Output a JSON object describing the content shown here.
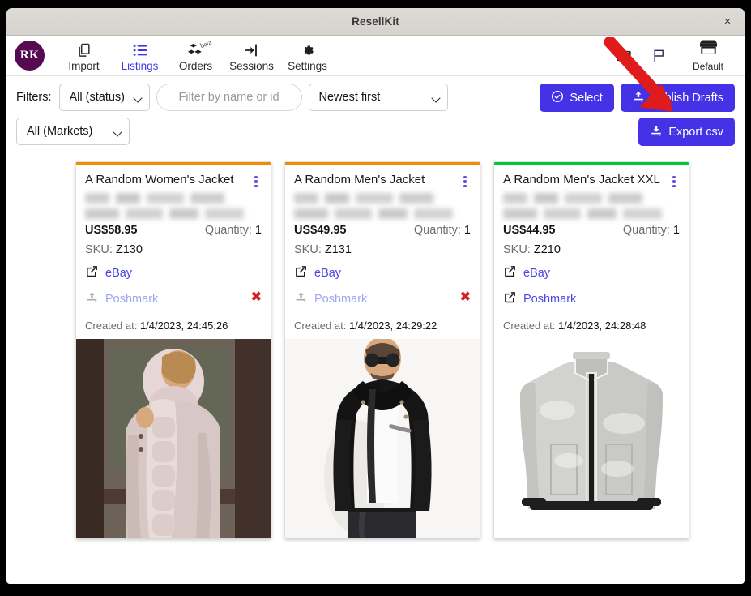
{
  "window": {
    "title": "ResellKit",
    "close_label": "×"
  },
  "nav": {
    "brand_initials": "RK",
    "items": [
      {
        "label": "Import",
        "icon": "copy-icon",
        "active": false,
        "badge": ""
      },
      {
        "label": "Listings",
        "icon": "list-icon",
        "active": true,
        "badge": ""
      },
      {
        "label": "Orders",
        "icon": "boxes-icon",
        "active": false,
        "badge": "beta"
      },
      {
        "label": "Sessions",
        "icon": "sign-in-icon",
        "active": false,
        "badge": ""
      },
      {
        "label": "Settings",
        "icon": "gear-icon",
        "active": false,
        "badge": ""
      }
    ],
    "mail_icon": "envelope-icon",
    "flag_icon": "flag-icon",
    "market": {
      "label": "Default",
      "icon": "storefront-icon"
    }
  },
  "filters": {
    "label": "Filters:",
    "status_value": "All (status)",
    "status_options": [
      "All (status)"
    ],
    "search_placeholder": "Filter by name or id",
    "search_value": "",
    "sort_value": "Newest first",
    "sort_options": [
      "Newest first"
    ],
    "market_value": "All (Markets)",
    "market_options": [
      "All (Markets)"
    ]
  },
  "actions": {
    "select_label": "Select",
    "select_icon": "check-circle-icon",
    "publish_label": "Publish Drafts",
    "publish_icon": "upload-icon",
    "export_label": "Export csv",
    "export_icon": "download-icon",
    "accent_color": "#4632e6"
  },
  "annotation": {
    "type": "red-arrow",
    "color": "#e01b1b",
    "points_to": "Publish Drafts"
  },
  "card_labels": {
    "quantity_label": "Quantity:",
    "sku_label": "SKU:",
    "created_label": "Created at:",
    "remove_glyph": "✖"
  },
  "cards": [
    {
      "accent_color": "#ef8c00",
      "title": "A Random Women's Jacket",
      "price": "US$58.95",
      "quantity": "1",
      "sku": "Z130",
      "created_at": "1/4/2023, 24:45:26",
      "markets": [
        {
          "name": "eBay",
          "state": "linked",
          "icon": "external-link-icon",
          "removable": false
        },
        {
          "name": "Poshmark",
          "state": "pending",
          "icon": "upload-icon",
          "removable": true
        }
      ],
      "image": "womens-pink-fur-hood-parka"
    },
    {
      "accent_color": "#ef8c00",
      "title": "A Random Men's Jacket",
      "price": "US$49.95",
      "quantity": "1",
      "sku": "Z131",
      "created_at": "1/4/2023, 24:29:22",
      "markets": [
        {
          "name": "eBay",
          "state": "linked",
          "icon": "external-link-icon",
          "removable": false
        },
        {
          "name": "Poshmark",
          "state": "pending",
          "icon": "upload-icon",
          "removable": true
        }
      ],
      "image": "mens-black-leather-biker-jacket"
    },
    {
      "accent_color": "#00c73c",
      "title": "A Random Men's Jacket XXL",
      "price": "US$44.95",
      "quantity": "1",
      "sku": "Z210",
      "created_at": "1/4/2023, 24:28:48",
      "markets": [
        {
          "name": "eBay",
          "state": "linked",
          "icon": "external-link-icon",
          "removable": false
        },
        {
          "name": "Poshmark",
          "state": "linked",
          "icon": "external-link-icon",
          "removable": false
        }
      ],
      "image": "grey-fleece-zip-jacket"
    }
  ]
}
